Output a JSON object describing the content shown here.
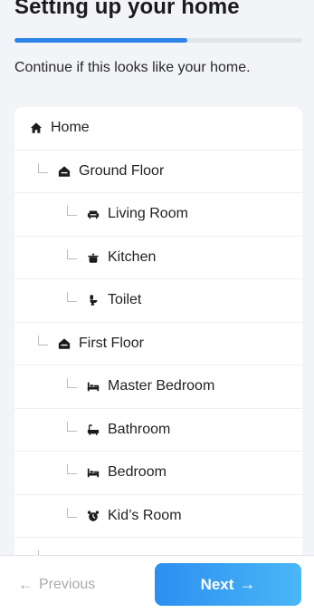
{
  "header": {
    "title": "Setting up your home",
    "progress_fraction": 0.6
  },
  "subtitle": "Continue if this looks like your home.",
  "tree": [
    {
      "label": "Home",
      "icon": "house-icon",
      "level": 0
    },
    {
      "label": "Ground Floor",
      "icon": "floor-icon",
      "level": 1
    },
    {
      "label": "Living Room",
      "icon": "sofa-icon",
      "level": 2
    },
    {
      "label": "Kitchen",
      "icon": "pot-icon",
      "level": 2
    },
    {
      "label": "Toilet",
      "icon": "toilet-icon",
      "level": 2
    },
    {
      "label": "First Floor",
      "icon": "floor-icon",
      "level": 1
    },
    {
      "label": "Master Bedroom",
      "icon": "bed-icon",
      "level": 2
    },
    {
      "label": "Bathroom",
      "icon": "bathtub-icon",
      "level": 2
    },
    {
      "label": "Bedroom",
      "icon": "bed-icon",
      "level": 2
    },
    {
      "label": "Kid’s Room",
      "icon": "alarm-clock-icon",
      "level": 2
    },
    {
      "label": "",
      "icon": "",
      "level": 1
    }
  ],
  "footer": {
    "previous_label": "Previous",
    "next_label": "Next"
  },
  "colors": {
    "accent": "#2d83e8",
    "button_gradient_start": "#2b8ff0",
    "button_gradient_end": "#4ab7f6",
    "background": "#f3f4f8"
  }
}
